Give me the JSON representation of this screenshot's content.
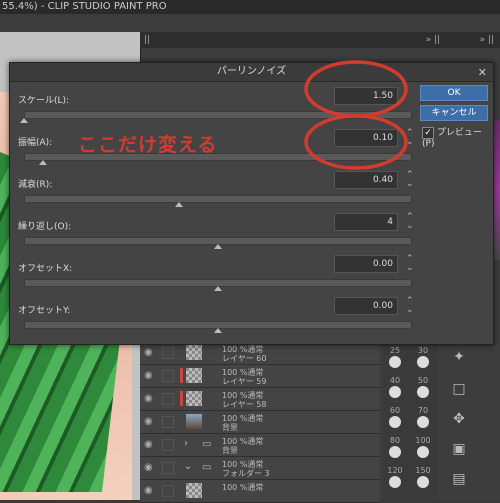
{
  "app": {
    "title": "55.4%) - CLIP STUDIO PAINT PRO",
    "panel_arrows": "» ||",
    "panel_arrows2": "» ||"
  },
  "dialog": {
    "title": "パーリンノイズ",
    "ok_label": "OK",
    "cancel_label": "キャンセル",
    "preview_label": "プレビュー(P)",
    "preview_checked": true,
    "params": [
      {
        "label": "スケール(L):",
        "value": "1.50",
        "slider": 0.0
      },
      {
        "label": "振幅(A):",
        "value": "0.10",
        "slider": 0.05
      },
      {
        "label": "減衰(R):",
        "value": "0.40",
        "slider": 0.4
      },
      {
        "label": "繰り返し(O):",
        "value": "4",
        "slider": 0.5
      },
      {
        "label": "オフセットX:",
        "value": "0.00",
        "slider": 0.5
      },
      {
        "label": "オフセットY:",
        "value": "0.00",
        "slider": 0.5
      }
    ]
  },
  "annotation": {
    "text": "ここだけ変える",
    "color": "#d23c2e"
  },
  "layers": [
    {
      "opacity": "100 %通常",
      "name": "レイヤー 60",
      "kind": "raster"
    },
    {
      "opacity": "100 %通常",
      "name": "レイヤー 59",
      "kind": "raster-red"
    },
    {
      "opacity": "100 %通常",
      "name": "レイヤー 58",
      "kind": "raster-red"
    },
    {
      "opacity": "100 %通常",
      "name": "背景",
      "kind": "image"
    },
    {
      "opacity": "100 %通常",
      "name": "背景",
      "kind": "folder"
    },
    {
      "opacity": "100 %通常",
      "name": "フォルダー 3",
      "kind": "folder-open"
    },
    {
      "opacity": "100 %通常",
      "name": "",
      "kind": "raster"
    }
  ],
  "brush_sizes": [
    "25",
    "30",
    "40",
    "50",
    "60",
    "70",
    "80",
    "100",
    "120",
    "150"
  ],
  "colors": {
    "accent": "#3e6ea8",
    "annotation": "#d23c2e"
  }
}
